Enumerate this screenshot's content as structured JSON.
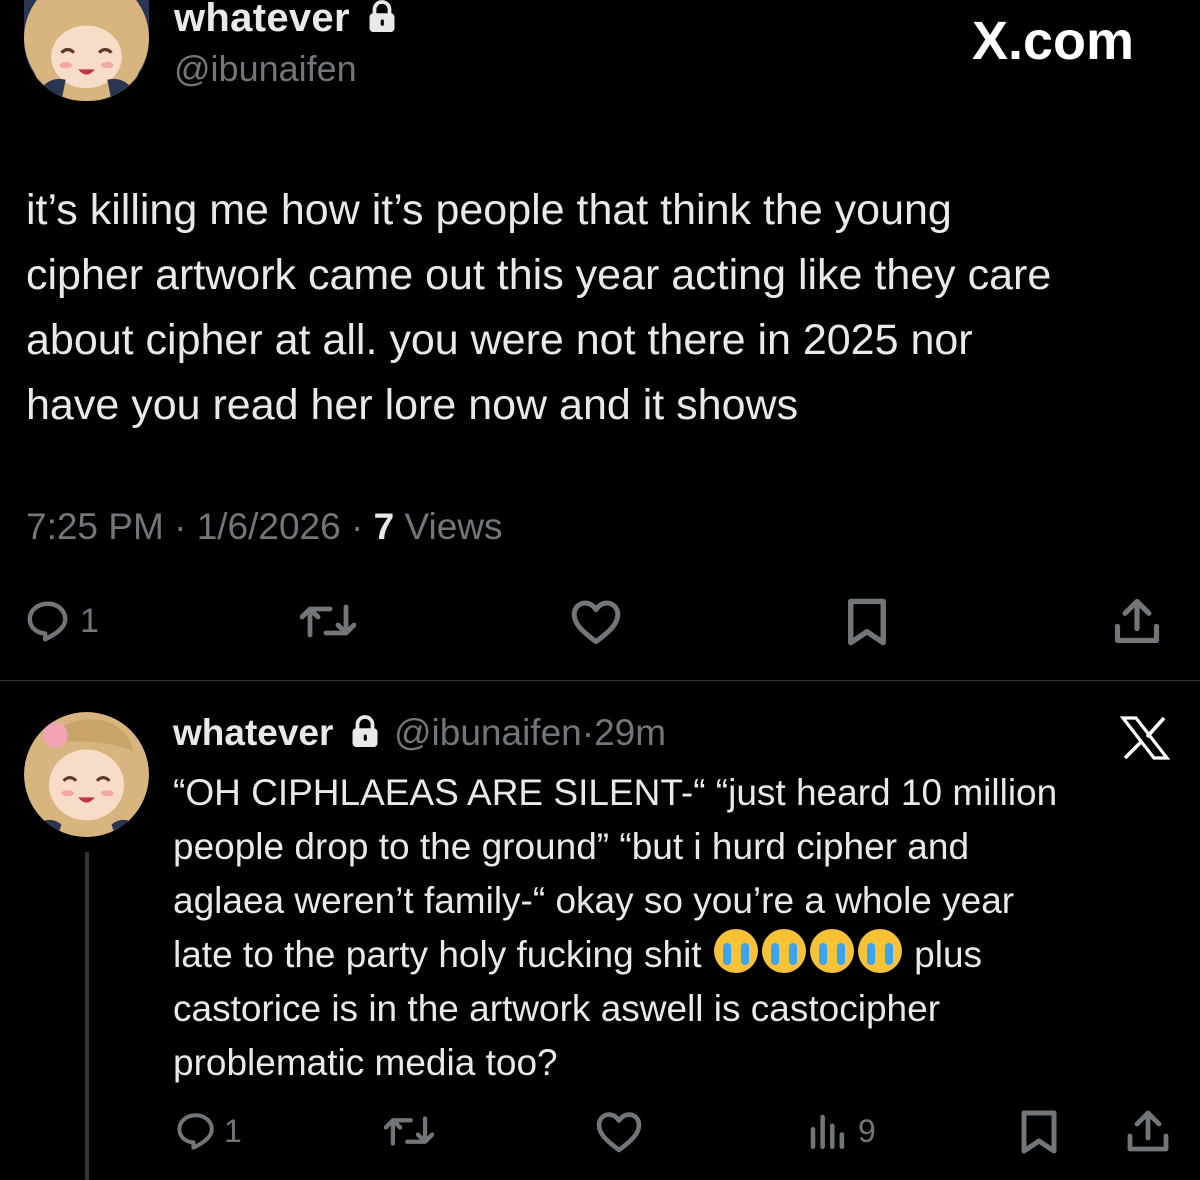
{
  "main_tweet": {
    "display_name": "whatever",
    "handle": "@ibunaifen",
    "watermark": "X.com",
    "text": "it’s killing me how it’s people that think the young\ncipher artwork came out this year acting like they care\nabout cipher at all. you were not there in 2025 nor\nhave you read her lore now and it shows",
    "time": "7:25 PM",
    "date": "1/6/2026",
    "views_count": "7",
    "views_label": "Views",
    "separator": " · ",
    "reply_count": "1"
  },
  "reply_tweet": {
    "display_name": "whatever",
    "handle": "@ibunaifen",
    "age": "29m",
    "separator": "·",
    "text_lines": [
      "“OH CIPHLAEAS ARE SILENT-“ “just heard 10 million",
      "people drop to the ground” “but i hurd cipher and",
      "aglaea weren’t family-“ okay so you’re a whole year",
      "late to the party holy fucking shit",
      "castorice is in the artwork aswell is castocipher",
      "problematic media too?"
    ],
    "line4_tail": "plus",
    "emoji_count": 4,
    "emoji": "loudly-crying-face",
    "reply_count": "1",
    "views_count": "9"
  },
  "icons": {
    "lock": "lock-icon",
    "reply": "reply-icon",
    "repost": "repost-icon",
    "like": "heart-icon",
    "views": "views-icon",
    "bookmark": "bookmark-icon",
    "share": "share-icon",
    "x": "x-logo-icon"
  },
  "colors": {
    "background": "#000000",
    "text": "#e7e9ea",
    "muted": "#71767b",
    "divider": "#2f3336"
  }
}
